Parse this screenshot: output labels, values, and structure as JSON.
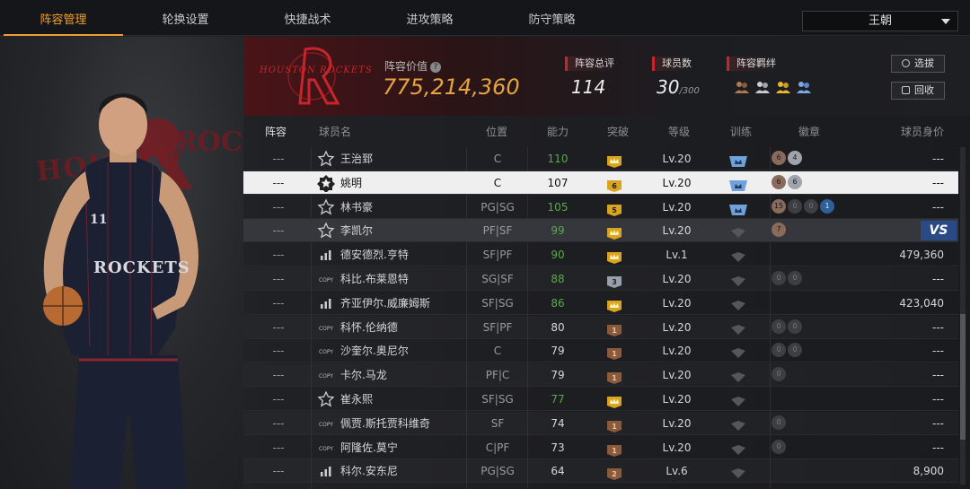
{
  "tabs": [
    {
      "label": "阵容管理",
      "active": true
    },
    {
      "label": "轮换设置",
      "active": false
    },
    {
      "label": "快捷战术",
      "active": false
    },
    {
      "label": "进攻策略",
      "active": false
    },
    {
      "label": "防守策略",
      "active": false
    }
  ],
  "dropdown_value": "王朝",
  "header": {
    "lineup_value_label": "阵容价值",
    "lineup_value": "775,214,360",
    "total_rating_label": "阵容总评",
    "total_rating": "114",
    "player_count_label": "球员数",
    "player_count": "30",
    "player_count_max": "/300",
    "bond_label": "阵容羁绊",
    "select_button": "选拔",
    "recycle_button": "回收"
  },
  "columns": {
    "lineup": "阵容",
    "name": "球员名",
    "position": "位置",
    "ability": "能力",
    "breakthrough": "突破",
    "level": "等级",
    "training": "训练",
    "badges": "徽章",
    "worth": "球员身价"
  },
  "rows": [
    {
      "lineup": "---",
      "type": "star",
      "name": "王治郅",
      "pos": "C",
      "ability": "110",
      "ability_green": true,
      "break": "crown",
      "level": "Lv.20",
      "train": "blue",
      "badges": [
        "6",
        "4"
      ],
      "worth": "---"
    },
    {
      "lineup": "---",
      "type": "starfill",
      "name": "姚明",
      "pos": "C",
      "ability": "107",
      "ability_green": false,
      "break": "6",
      "level": "Lv.20",
      "train": "blue",
      "badges": [
        "6",
        "6"
      ],
      "worth": "---",
      "selected": true
    },
    {
      "lineup": "---",
      "type": "star",
      "name": "林书豪",
      "pos": "PG|SG",
      "ability": "105",
      "ability_green": true,
      "break": "5",
      "level": "Lv.20",
      "train": "blue",
      "badges": [
        "15",
        "0",
        "0",
        "1"
      ],
      "worth": "---"
    },
    {
      "lineup": "---",
      "type": "star",
      "name": "李凯尔",
      "pos": "PF|SF",
      "ability": "99",
      "ability_green": true,
      "break": "crown",
      "level": "Lv.20",
      "train": "gray",
      "badges": [
        "7"
      ],
      "worth": "VS",
      "highlight": true
    },
    {
      "lineup": "---",
      "type": "bars",
      "name": "德安德烈.亨特",
      "pos": "SF|PF",
      "ability": "90",
      "ability_green": true,
      "break": "crown",
      "level": "Lv.1",
      "train": "gray",
      "badges": [],
      "worth": "479,360"
    },
    {
      "lineup": "---",
      "type": "copy",
      "name": "科比.布莱恩特",
      "pos": "SG|SF",
      "ability": "88",
      "ability_green": true,
      "break": "3",
      "level": "Lv.20",
      "train": "gray",
      "badges": [
        "0",
        "0"
      ],
      "worth": "---"
    },
    {
      "lineup": "---",
      "type": "bars",
      "name": "齐亚伊尔.威廉姆斯",
      "pos": "SF|SG",
      "ability": "86",
      "ability_green": true,
      "break": "crown",
      "level": "Lv.20",
      "train": "gray",
      "badges": [],
      "worth": "423,040"
    },
    {
      "lineup": "---",
      "type": "copy",
      "name": "科怀.伦纳德",
      "pos": "SF|PF",
      "ability": "80",
      "ability_green": false,
      "break": "1",
      "level": "Lv.20",
      "train": "gray",
      "badges": [
        "0",
        "0"
      ],
      "worth": "---"
    },
    {
      "lineup": "---",
      "type": "copy",
      "name": "沙奎尔.奥尼尔",
      "pos": "C",
      "ability": "79",
      "ability_green": false,
      "break": "1",
      "level": "Lv.20",
      "train": "gray",
      "badges": [
        "0",
        "0"
      ],
      "worth": "---"
    },
    {
      "lineup": "---",
      "type": "copy",
      "name": "卡尔.马龙",
      "pos": "PF|C",
      "ability": "79",
      "ability_green": false,
      "break": "1",
      "level": "Lv.20",
      "train": "gray",
      "badges": [
        "0"
      ],
      "worth": "---"
    },
    {
      "lineup": "---",
      "type": "star",
      "name": "崔永熙",
      "pos": "SF|SG",
      "ability": "77",
      "ability_green": true,
      "break": "crown",
      "level": "Lv.20",
      "train": "gray",
      "badges": [],
      "worth": "---"
    },
    {
      "lineup": "---",
      "type": "copy",
      "name": "佩贾.斯托贾科维奇",
      "pos": "SF",
      "ability": "74",
      "ability_green": false,
      "break": "1",
      "level": "Lv.20",
      "train": "gray",
      "badges": [
        "0"
      ],
      "worth": "---"
    },
    {
      "lineup": "---",
      "type": "copy",
      "name": "阿隆佐.莫宁",
      "pos": "C|PF",
      "ability": "73",
      "ability_green": false,
      "break": "1",
      "level": "Lv.20",
      "train": "gray",
      "badges": [
        "0"
      ],
      "worth": "---"
    },
    {
      "lineup": "---",
      "type": "bars",
      "name": "科尔.安东尼",
      "pos": "PG|SG",
      "ability": "64",
      "ability_green": false,
      "break": "2",
      "level": "Lv.6",
      "train": "gray",
      "badges": [],
      "worth": "8,900"
    }
  ],
  "colors": {
    "accent": "#f0a030",
    "team_red": "#c8242b",
    "value_gold": "#e6a440",
    "green": "#5aa84a",
    "vs_blue": "#2a4a86"
  },
  "logo_text": "HOUSTON ROCKETS",
  "art_text_left": "HOUSTO",
  "art_text_right": "ROCK",
  "jersey_text": "ROCKETS",
  "jersey_number": "11"
}
